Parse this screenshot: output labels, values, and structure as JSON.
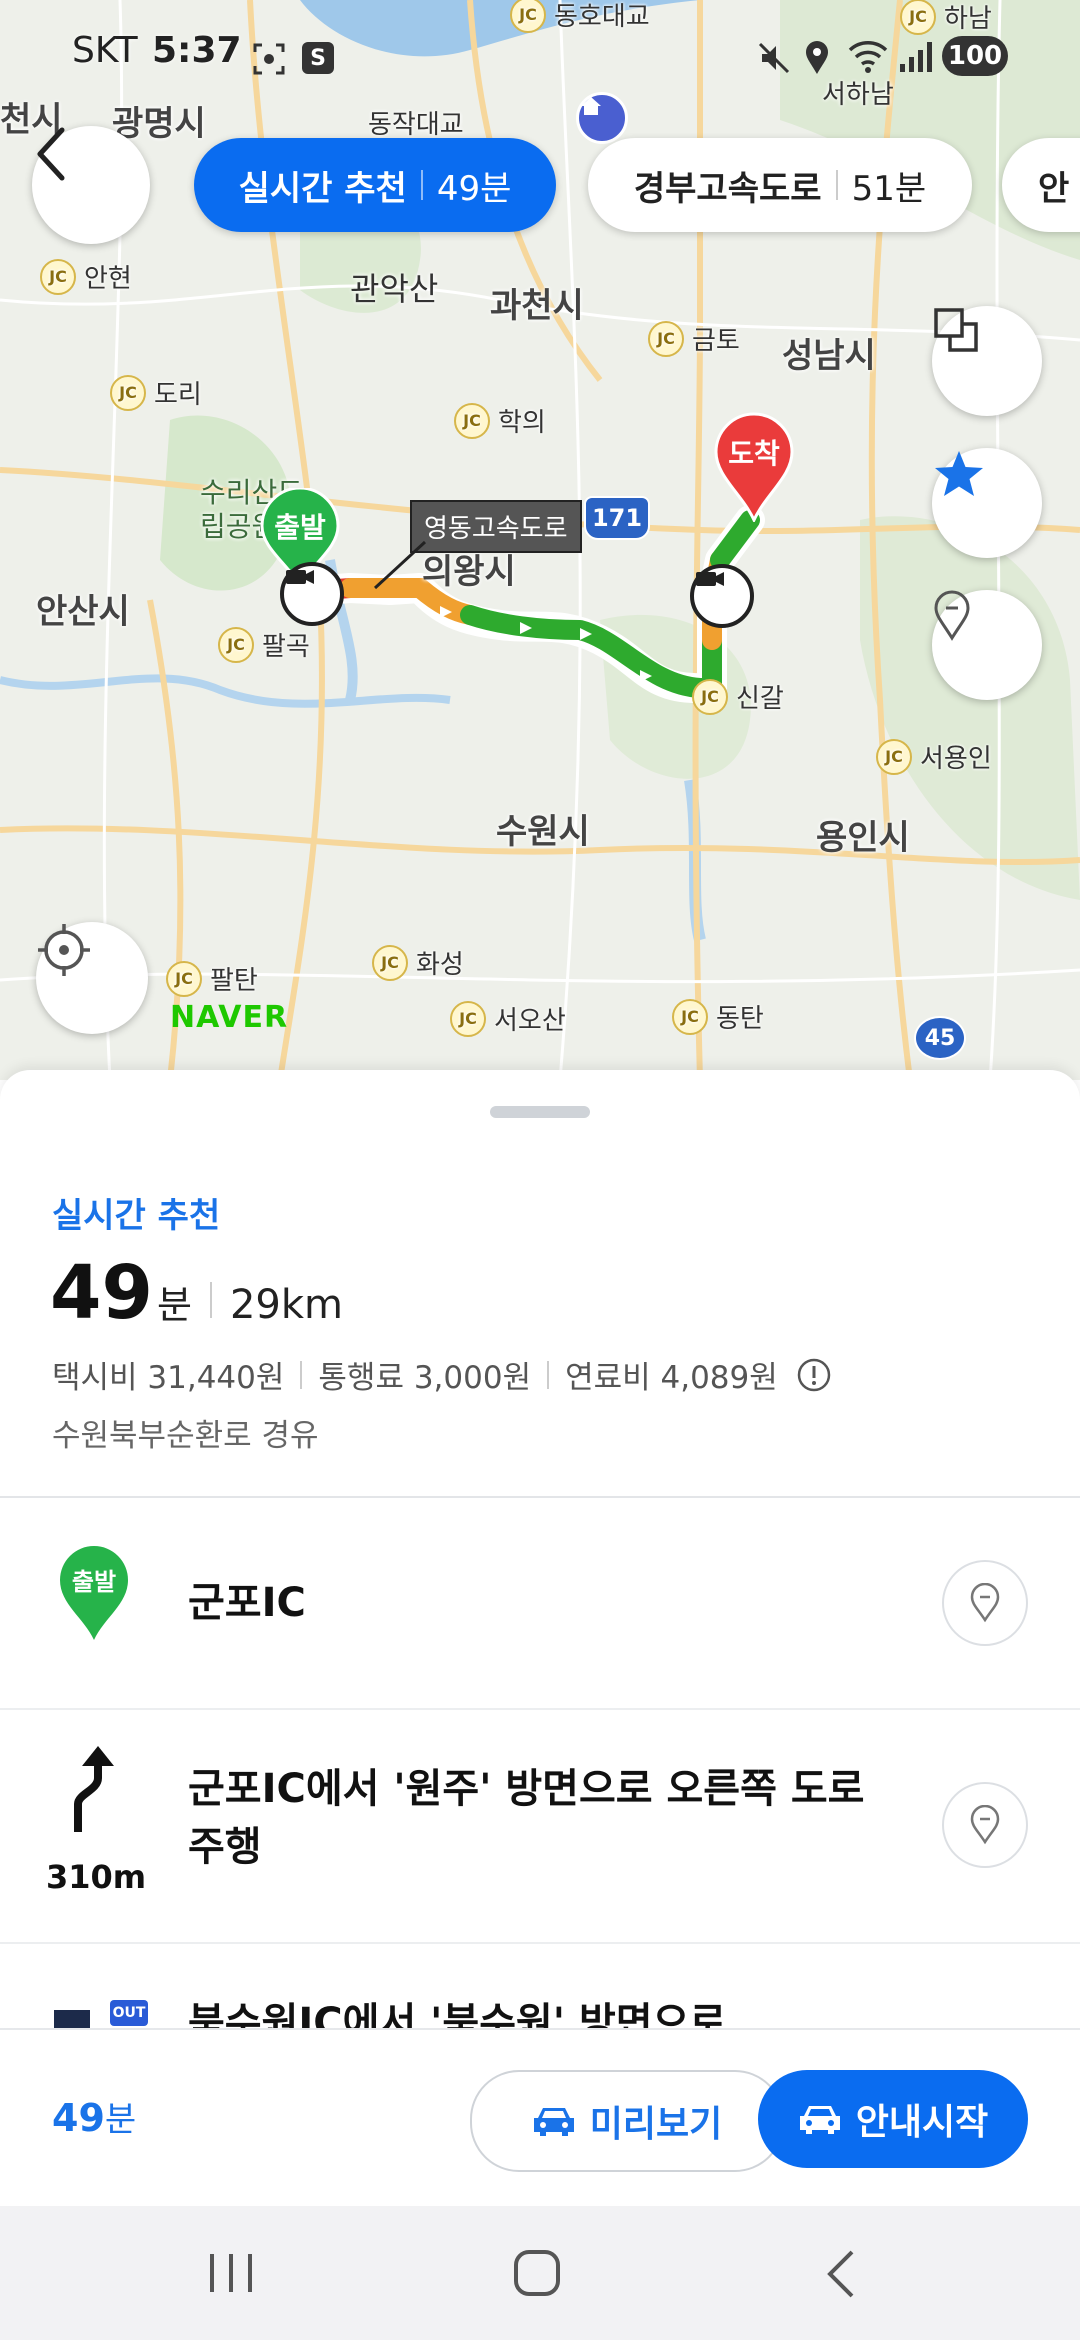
{
  "status_bar": {
    "carrier": "SKT",
    "time": "5:37",
    "battery": "100"
  },
  "map": {
    "places": [
      {
        "name": "광명시",
        "cls": "big"
      },
      {
        "name": "관악산",
        "cls": ""
      },
      {
        "name": "과천시",
        "cls": "big"
      },
      {
        "name": "성남시",
        "cls": "big"
      },
      {
        "name": "의왕시",
        "cls": "big"
      },
      {
        "name": "안산시",
        "cls": "big"
      },
      {
        "name": "수원시",
        "cls": "big"
      },
      {
        "name": "용인시",
        "cls": "big"
      },
      {
        "name": "동작대교",
        "cls": ""
      },
      {
        "name": "서하남",
        "cls": ""
      },
      {
        "name": "수리산도립공원",
        "cls": ""
      },
      {
        "name": "천시",
        "cls": "big"
      }
    ],
    "junctions": [
      "안현",
      "도리",
      "학의",
      "금토",
      "팔곡",
      "신갈",
      "서용인",
      "화성",
      "팔탄",
      "서오산",
      "동탄",
      "동호대교",
      "하남"
    ],
    "road_label": "영동고속도로",
    "road_badge": "171",
    "highway_badge": "45",
    "start_marker": "출발",
    "end_marker": "도착",
    "naver_logo": "NAVER"
  },
  "route_chips": [
    {
      "name": "실시간 추천",
      "time": "49분",
      "active": true
    },
    {
      "name": "경부고속도로",
      "time": "51분",
      "active": false
    },
    {
      "name": "안",
      "time": "",
      "active": false
    }
  ],
  "summary": {
    "type": "실시간 추천",
    "minutes": "49",
    "minutes_unit": "분",
    "distance": "29km",
    "taxi": "택시비 31,440원",
    "toll": "통행료 3,000원",
    "fuel": "연료비 4,089원",
    "via": "수원북부순환로 경유"
  },
  "steps": [
    {
      "icon": "start",
      "icon_label": "출발",
      "text": "군포IC",
      "distance": ""
    },
    {
      "icon": "turn",
      "icon_label": "",
      "text": "군포IC에서 '원주' 방면으로 오른쪽 도로 주행",
      "distance": "310m"
    },
    {
      "icon": "exit",
      "icon_label": "OUT",
      "text": "북수원IC에서 '북수원' 방면으로",
      "distance": ""
    }
  ],
  "bottom_bar": {
    "total_time": "49",
    "total_unit": "분",
    "preview_label": "미리보기",
    "start_label": "안내시작"
  },
  "colors": {
    "accent": "#0a6cf0",
    "route_green": "#2eaa2e",
    "route_orange": "#f0a030",
    "route_red": "#e23b2f"
  }
}
